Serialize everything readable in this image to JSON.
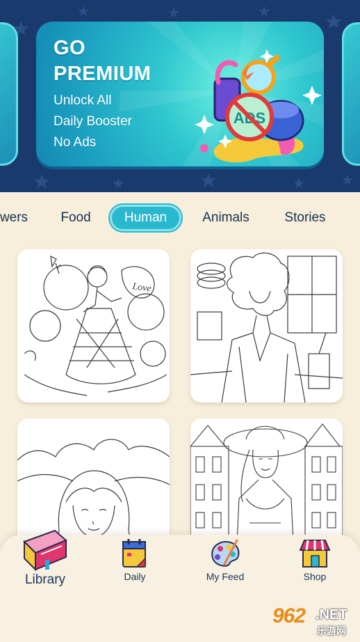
{
  "premium": {
    "title_line1": "GO",
    "title_line2": "PREMIUM",
    "features": [
      "Unlock All",
      "Daily Booster",
      "No Ads"
    ],
    "art_badge": "ADS"
  },
  "categories": {
    "tabs": [
      "wers",
      "Food",
      "Human",
      "Animals",
      "Stories"
    ],
    "active": "Human"
  },
  "artworks": [
    {
      "subject": "girl-with-balloons-and-rose",
      "badge": "Love"
    },
    {
      "subject": "curly-haired-woman-cafe"
    },
    {
      "subject": "girl-with-bangs-clouds"
    },
    {
      "subject": "woman-with-hat-street"
    }
  ],
  "nav": {
    "items": [
      {
        "label": "Library",
        "icon": "book-icon",
        "active": true
      },
      {
        "label": "Daily",
        "icon": "calendar-icon",
        "active": false
      },
      {
        "label": "My Feed",
        "icon": "palette-icon",
        "active": false
      },
      {
        "label": "Shop",
        "icon": "shop-icon",
        "active": false
      }
    ]
  },
  "watermark": {
    "number": "962",
    "suffix": ".NET",
    "sub": "乐游网"
  },
  "colors": {
    "accent": "#2ab8cf",
    "navy": "#16324f",
    "background": "#f7eedc",
    "hero_bg": "#1a3a6e"
  }
}
